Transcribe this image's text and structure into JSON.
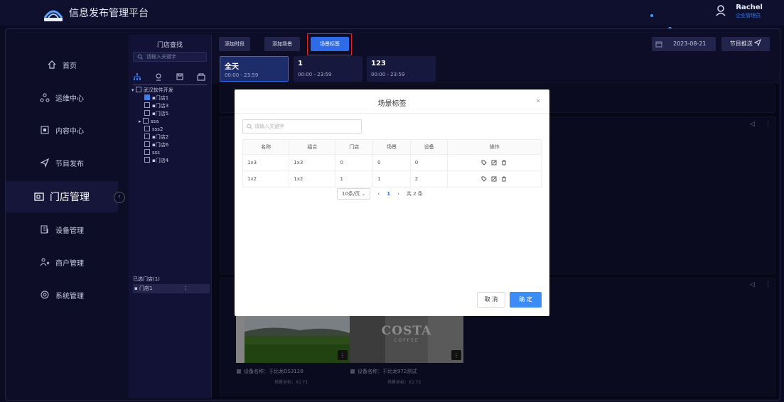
{
  "header": {
    "app_title": "信息发布管理平台",
    "logo_icon": "platform-logo-icon",
    "user_name": "Rachel",
    "user_role": "企业管理员"
  },
  "nav": {
    "items": [
      {
        "label": "首页",
        "icon": "home-icon"
      },
      {
        "label": "运维中心",
        "icon": "ops-icon"
      },
      {
        "label": "内容中心",
        "icon": "content-icon"
      },
      {
        "label": "节目发布",
        "icon": "send-icon"
      },
      {
        "label": "门店管理",
        "icon": "store-icon",
        "active": true
      },
      {
        "label": "设备管理",
        "icon": "device-icon"
      },
      {
        "label": "商户管理",
        "icon": "merchant-icon"
      },
      {
        "label": "系统管理",
        "icon": "system-icon"
      }
    ]
  },
  "store_panel": {
    "title": "门店查找",
    "search_placeholder": "请输入关键字",
    "tree": [
      {
        "label": "武汉软件开发",
        "level": 0,
        "expanded": true,
        "checked": false
      },
      {
        "label": "门店1",
        "level": 1,
        "checked": true
      },
      {
        "label": "门店3",
        "level": 1,
        "checked": false
      },
      {
        "label": "门店5",
        "level": 1,
        "checked": false
      },
      {
        "label": "ssa",
        "level": 1,
        "collapsed": true,
        "checked": false
      },
      {
        "label": "sss2",
        "level": 1,
        "checked": false
      },
      {
        "label": "门店2",
        "level": 1,
        "checked": false
      },
      {
        "label": "门店6",
        "level": 1,
        "checked": false
      },
      {
        "label": "sss",
        "level": 1,
        "checked": false
      },
      {
        "label": "门店4",
        "level": 1,
        "checked": false
      }
    ],
    "selected_title": "已选门店(1)",
    "selected_items": [
      "门店1"
    ]
  },
  "toolbar": {
    "add_period": "添加时段",
    "add_scene": "添加场景",
    "scene_tag": "场景标签",
    "date": "2023-08-21",
    "push": "节目推送"
  },
  "periods": [
    {
      "name": "全天",
      "time": "00:00 - 23:59",
      "active": true
    },
    {
      "name": "1",
      "time": "00:00 - 23:59"
    },
    {
      "name": "123",
      "time": "00:00 - 23:59"
    }
  ],
  "devices": [
    {
      "caption": "设备名称：于比龙DS3128",
      "coords": "场景坐标：X1 Y1"
    },
    {
      "caption": "设备名称：于比龙972测试",
      "coords": "场景坐标：X1 Y2"
    }
  ],
  "thumb_text": {
    "costa": "COSTA",
    "coffee": "COFFEE"
  },
  "modal": {
    "title": "场景标签",
    "search_placeholder": "请输入关键字",
    "columns": [
      "名称",
      "组合",
      "门店",
      "场景",
      "设备",
      "操作"
    ],
    "rows": [
      [
        "1x3",
        "1x3",
        "0",
        "0",
        "0"
      ],
      [
        "1x2",
        "1x2",
        "1",
        "1",
        "2"
      ]
    ],
    "page_size": "10条/页",
    "current_page": "1",
    "total": "共 2 条",
    "cancel": "取 消",
    "confirm": "确 定"
  },
  "colors": {
    "accent": "#2e6be8",
    "highlight": "#e02424",
    "background": "#0b0b24"
  }
}
